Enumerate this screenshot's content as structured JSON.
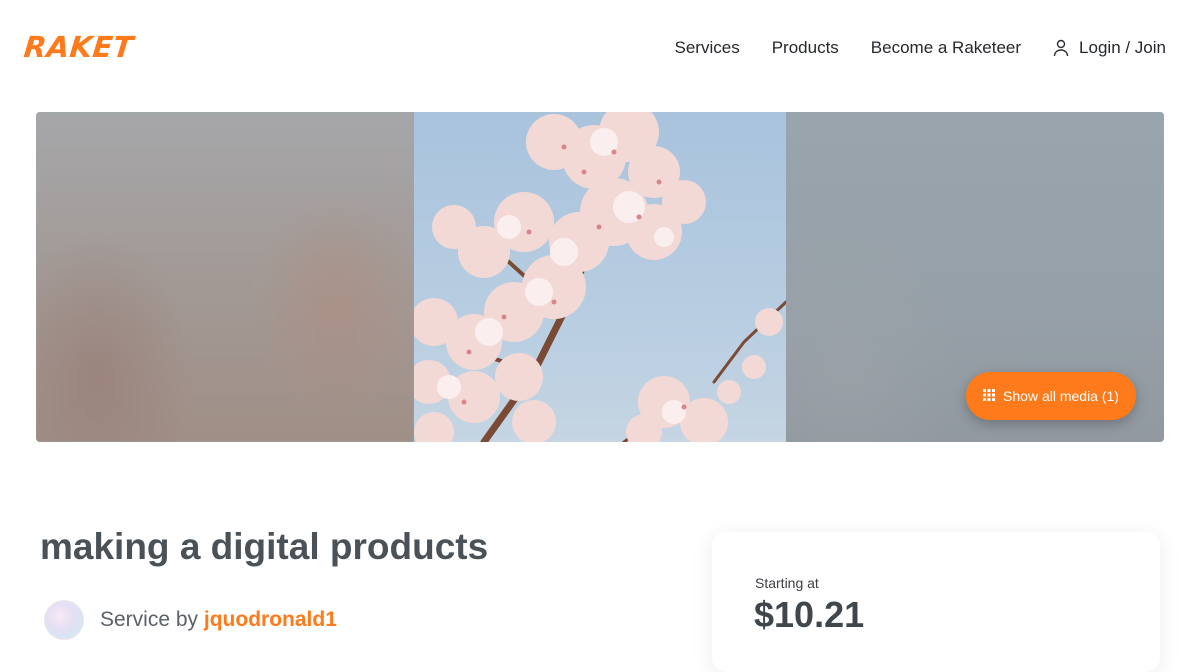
{
  "brand": {
    "logo_text": "RAKET",
    "accent_color": "#ff7a1a"
  },
  "nav": {
    "items": [
      {
        "label": "Services"
      },
      {
        "label": "Products"
      },
      {
        "label": "Become a Raketeer"
      }
    ],
    "login_label": "Login / Join",
    "login_icon": "user-icon"
  },
  "hero": {
    "media_button_label": "Show all media (1)",
    "media_button_icon": "grid-icon",
    "image_subject": "cherry-blossom-photo"
  },
  "service": {
    "title": "making a digital products",
    "seller_prefix": "Service by",
    "seller_name": "jquodronald1"
  },
  "pricing": {
    "label": "Starting at",
    "price": "$10.21"
  }
}
